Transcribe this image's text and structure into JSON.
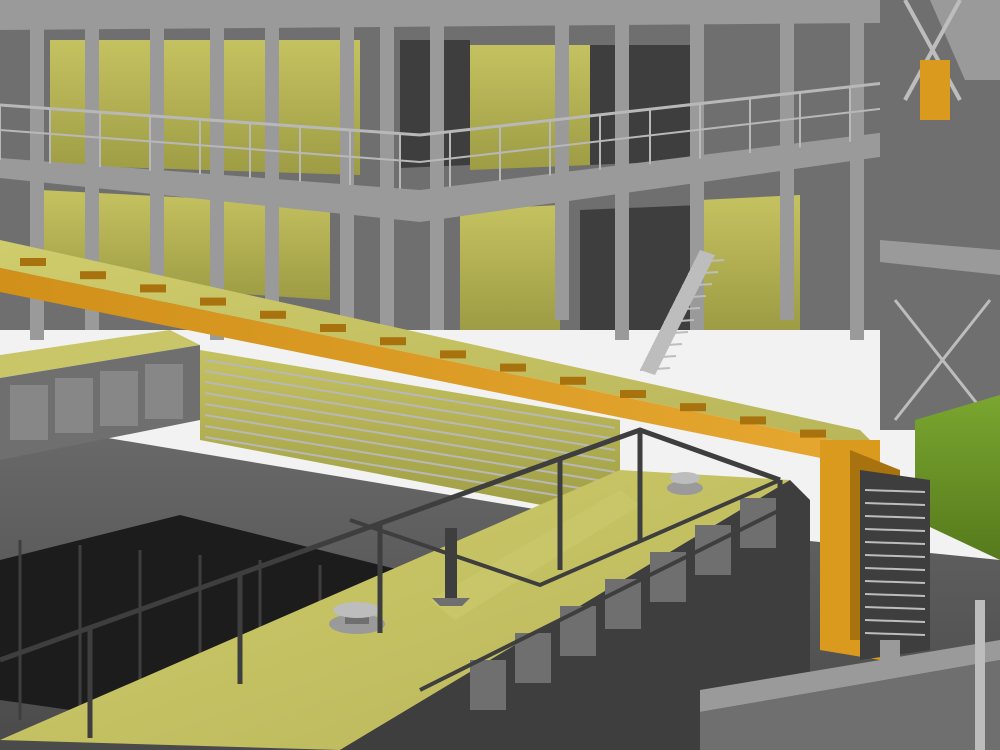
{
  "scene": {
    "palette": {
      "sky": "#f2f2f2",
      "steel_dark": "#3e3e3e",
      "steel_mid": "#6f6f6f",
      "steel_light": "#9a9a9a",
      "steel_pale": "#bdbdbd",
      "rail": "#b8b8b8",
      "floor": "#5a5a5a",
      "pit": "#1c1c1c",
      "yellow_pale": "#c9c66a",
      "yellow_top": "#d2cf72",
      "orange": "#d99a1e",
      "orange_dark": "#a8720f",
      "green": "#6f9a2a"
    }
  }
}
